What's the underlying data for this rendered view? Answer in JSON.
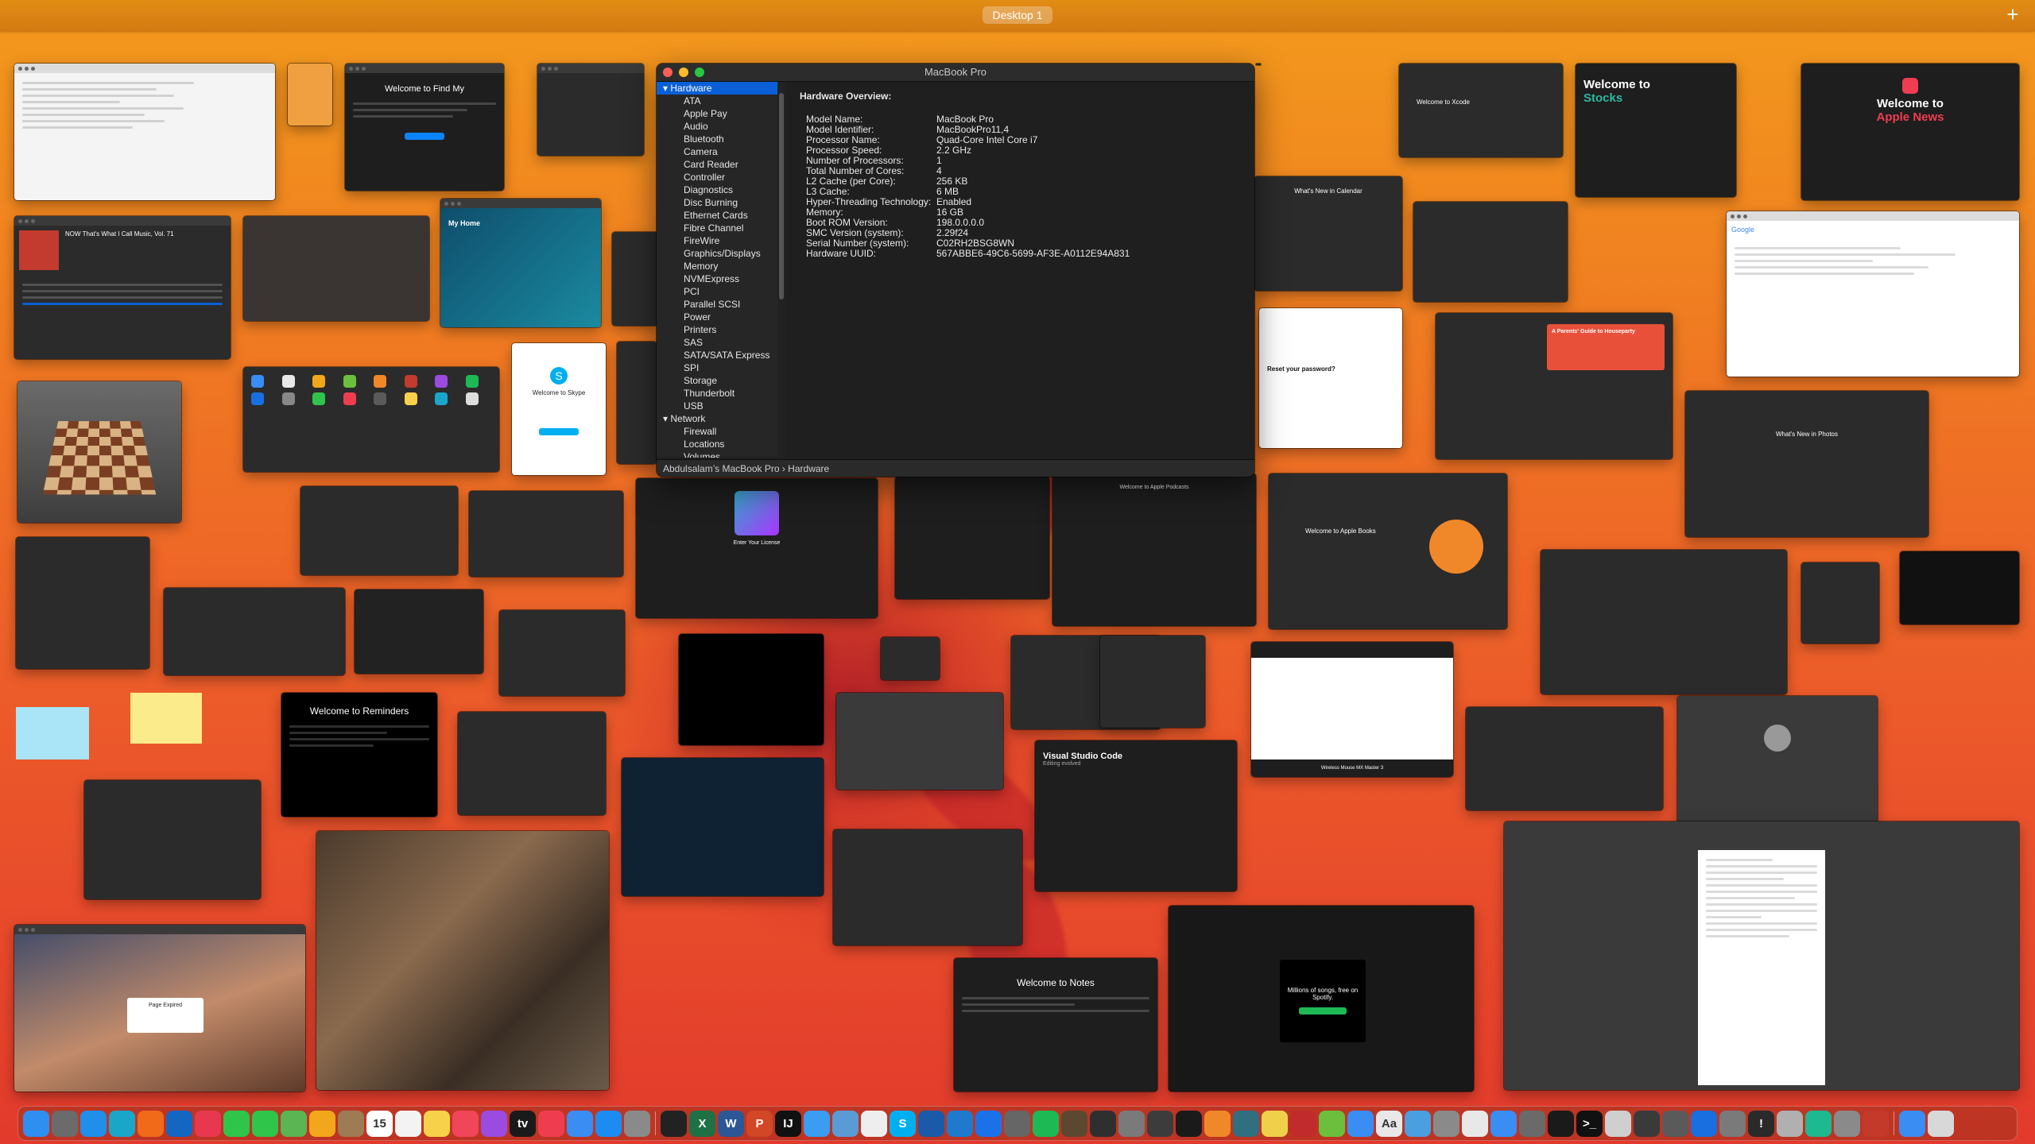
{
  "spaces_bar": {
    "desktop_label": "Desktop 1",
    "add_label": "+"
  },
  "sysinfo": {
    "title": "MacBook Pro",
    "sidebar": [
      {
        "label": "Hardware",
        "group": true,
        "selected": true
      },
      {
        "label": "ATA"
      },
      {
        "label": "Apple Pay"
      },
      {
        "label": "Audio"
      },
      {
        "label": "Bluetooth"
      },
      {
        "label": "Camera"
      },
      {
        "label": "Card Reader"
      },
      {
        "label": "Controller"
      },
      {
        "label": "Diagnostics"
      },
      {
        "label": "Disc Burning"
      },
      {
        "label": "Ethernet Cards"
      },
      {
        "label": "Fibre Channel"
      },
      {
        "label": "FireWire"
      },
      {
        "label": "Graphics/Displays"
      },
      {
        "label": "Memory"
      },
      {
        "label": "NVMExpress"
      },
      {
        "label": "PCI"
      },
      {
        "label": "Parallel SCSI"
      },
      {
        "label": "Power"
      },
      {
        "label": "Printers"
      },
      {
        "label": "SAS"
      },
      {
        "label": "SATA/SATA Express"
      },
      {
        "label": "SPI"
      },
      {
        "label": "Storage"
      },
      {
        "label": "Thunderbolt"
      },
      {
        "label": "USB"
      },
      {
        "label": "Network",
        "group": true
      },
      {
        "label": "Firewall"
      },
      {
        "label": "Locations"
      },
      {
        "label": "Volumes"
      }
    ],
    "heading": "Hardware Overview:",
    "overview": [
      {
        "k": "Model Name:",
        "v": "MacBook Pro"
      },
      {
        "k": "Model Identifier:",
        "v": "MacBookPro11,4"
      },
      {
        "k": "Processor Name:",
        "v": "Quad-Core Intel Core i7"
      },
      {
        "k": "Processor Speed:",
        "v": "2.2 GHz"
      },
      {
        "k": "Number of Processors:",
        "v": "1"
      },
      {
        "k": "Total Number of Cores:",
        "v": "4"
      },
      {
        "k": "L2 Cache (per Core):",
        "v": "256 KB"
      },
      {
        "k": "L3 Cache:",
        "v": "6 MB"
      },
      {
        "k": "Hyper-Threading Technology:",
        "v": "Enabled"
      },
      {
        "k": "Memory:",
        "v": "16 GB"
      },
      {
        "k": "Boot ROM Version:",
        "v": "198.0.0.0.0"
      },
      {
        "k": "SMC Version (system):",
        "v": "2.29f24"
      },
      {
        "k": "Serial Number (system):",
        "v": "C02RH2BSG8WN"
      },
      {
        "k": "Hardware UUID:",
        "v": "567ABBE6-49C6-5699-AF3E-A0112E94A831"
      }
    ],
    "path": "Abdulsalam’s MacBook Pro › Hardware"
  },
  "thumbs": {
    "find_my": "Welcome to Find My",
    "now_music": "NOW That's What I Call Music, Vol. 71",
    "my_home": "My Home",
    "skype": "Welcome to Skype",
    "xcode": "Welcome to Xcode",
    "stocks_line1": "Welcome to",
    "stocks_line2": "Stocks",
    "news_line1": "Welcome to",
    "news_line2": "Apple News",
    "calendar": "What's New in Calendar",
    "twitter_reset": "Reset your password?",
    "photos": "What's New in Photos",
    "books": "Welcome to Apple Books",
    "license": "Enter Your License",
    "podcasts": "Welcome to Apple Podcasts",
    "reminders": "Welcome to Reminders",
    "vscode": "Visual Studio Code",
    "vscode_sub": "Editing evolved",
    "notes": "Welcome to Notes",
    "spotify": "Millions of songs, free on Spotify.",
    "mouse": "Wireless Mouse MX Master 3",
    "page_expired": "Page Expired",
    "google": "Google",
    "stories": "A Parents' Guide to Houseparty"
  },
  "dock": {
    "apps": [
      {
        "name": "finder-icon",
        "color": "#2f8ff0",
        "glyph": ""
      },
      {
        "name": "launchpad-icon",
        "color": "#6b6b6b",
        "glyph": ""
      },
      {
        "name": "safari-icon",
        "color": "#1f8fea",
        "glyph": ""
      },
      {
        "name": "edge-icon",
        "color": "#1aa6c8",
        "glyph": ""
      },
      {
        "name": "firefox-icon",
        "color": "#f06a1a",
        "glyph": ""
      },
      {
        "name": "outlook-icon",
        "color": "#1466c3",
        "glyph": ""
      },
      {
        "name": "news-icon",
        "color": "#e8384f",
        "glyph": ""
      },
      {
        "name": "facetime-icon",
        "color": "#2ec54a",
        "glyph": ""
      },
      {
        "name": "messages-icon",
        "color": "#2ec54a",
        "glyph": ""
      },
      {
        "name": "maps-icon",
        "color": "#5ab552",
        "glyph": ""
      },
      {
        "name": "photos-icon",
        "color": "#f2a71a",
        "glyph": ""
      },
      {
        "name": "contacts-icon",
        "color": "#9c7b55",
        "glyph": ""
      },
      {
        "name": "calendar-icon",
        "color": "#ffffff",
        "glyph": "15"
      },
      {
        "name": "reminders-icon",
        "color": "#f3f3f3",
        "glyph": ""
      },
      {
        "name": "notes-icon",
        "color": "#f7d14a",
        "glyph": ""
      },
      {
        "name": "music-icon",
        "color": "#f1455a",
        "glyph": ""
      },
      {
        "name": "podcasts-icon",
        "color": "#9b4be0",
        "glyph": ""
      },
      {
        "name": "tv-icon",
        "color": "#1a1a1a",
        "glyph": "tv"
      },
      {
        "name": "news2-icon",
        "color": "#ef3d50",
        "glyph": ""
      },
      {
        "name": "keynote-icon",
        "color": "#3a8df2",
        "glyph": ""
      },
      {
        "name": "appstore-icon",
        "color": "#1d8cf2",
        "glyph": ""
      },
      {
        "name": "settings-icon",
        "color": "#8a8a8a",
        "glyph": ""
      },
      {
        "name": "sep"
      },
      {
        "name": "piano-icon",
        "color": "#222222",
        "glyph": ""
      },
      {
        "name": "excel-icon",
        "color": "#1e7145",
        "glyph": "X"
      },
      {
        "name": "word-icon",
        "color": "#2b5797",
        "glyph": "W"
      },
      {
        "name": "powerpoint-icon",
        "color": "#d24726",
        "glyph": "P"
      },
      {
        "name": "intellij-icon",
        "color": "#111111",
        "glyph": "IJ"
      },
      {
        "name": "folder-icon",
        "color": "#3a9df2",
        "glyph": ""
      },
      {
        "name": "preview-icon",
        "color": "#5b9bd5",
        "glyph": ""
      },
      {
        "name": "textedit-icon",
        "color": "#eeeeee",
        "glyph": ""
      },
      {
        "name": "skype-icon",
        "color": "#00aff0",
        "glyph": "S"
      },
      {
        "name": "virtualbox-icon",
        "color": "#1a5aa8",
        "glyph": ""
      },
      {
        "name": "vscode-icon",
        "color": "#1f7acd",
        "glyph": ""
      },
      {
        "name": "xcode-icon",
        "color": "#1b72e8",
        "glyph": ""
      },
      {
        "name": "logitech-icon",
        "color": "#666666",
        "glyph": ""
      },
      {
        "name": "spotify-icon",
        "color": "#1db954",
        "glyph": ""
      },
      {
        "name": "chess-icon",
        "color": "#5c4730",
        "glyph": ""
      },
      {
        "name": "dashboard-icon",
        "color": "#2f2f2f",
        "glyph": ""
      },
      {
        "name": "gears-icon",
        "color": "#7a7a7a",
        "glyph": ""
      },
      {
        "name": "timemachine-icon",
        "color": "#3c3c3c",
        "glyph": ""
      },
      {
        "name": "activity-icon",
        "color": "#1a1a1a",
        "glyph": ""
      },
      {
        "name": "books-icon",
        "color": "#f0882a",
        "glyph": ""
      },
      {
        "name": "grapher-icon",
        "color": "#2f6f7f",
        "glyph": ""
      },
      {
        "name": "stickies-icon",
        "color": "#f0d04a",
        "glyph": ""
      },
      {
        "name": "photobooth-icon",
        "color": "#c22b2b",
        "glyph": ""
      },
      {
        "name": "cube-icon",
        "color": "#6cbf3c",
        "glyph": ""
      },
      {
        "name": "mail-icon",
        "color": "#3a8df2",
        "glyph": ""
      },
      {
        "name": "character-icon",
        "color": "#e8e8e8",
        "glyph": "Aa"
      },
      {
        "name": "screenshot-icon",
        "color": "#4a9fe0",
        "glyph": ""
      },
      {
        "name": "scripteditor-icon",
        "color": "#8a8a8a",
        "glyph": ""
      },
      {
        "name": "shield-icon",
        "color": "#e8e8e8",
        "glyph": ""
      },
      {
        "name": "wifi-icon",
        "color": "#3a8df2",
        "glyph": ""
      },
      {
        "name": "voiceover-icon",
        "color": "#6a6a6a",
        "glyph": ""
      },
      {
        "name": "console-icon",
        "color": "#1a1a1a",
        "glyph": ""
      },
      {
        "name": "terminal-icon",
        "color": "#111111",
        "glyph": ">_"
      },
      {
        "name": "diskutility-icon",
        "color": "#cfcfcf",
        "glyph": ""
      },
      {
        "name": "compass-icon",
        "color": "#3a3a3a",
        "glyph": ""
      },
      {
        "name": "migration-icon",
        "color": "#5a5a5a",
        "glyph": ""
      },
      {
        "name": "bluetooth-icon",
        "color": "#1a6fe0",
        "glyph": ""
      },
      {
        "name": "network-icon",
        "color": "#7a7a7a",
        "glyph": ""
      },
      {
        "name": "console-warning-icon",
        "color": "#2a2a2a",
        "glyph": "!"
      },
      {
        "name": "sysinfo-icon",
        "color": "#b0b0b0",
        "glyph": ""
      },
      {
        "name": "chip-icon",
        "color": "#1db990",
        "glyph": ""
      },
      {
        "name": "printer-icon",
        "color": "#8a8a8a",
        "glyph": ""
      },
      {
        "name": "vpn-icon",
        "color": "#c33a2a",
        "glyph": ""
      },
      {
        "name": "sep"
      },
      {
        "name": "downloads-icon",
        "color": "#3a8df2",
        "glyph": ""
      },
      {
        "name": "trash-icon",
        "color": "#d8d8d8",
        "glyph": ""
      }
    ]
  }
}
